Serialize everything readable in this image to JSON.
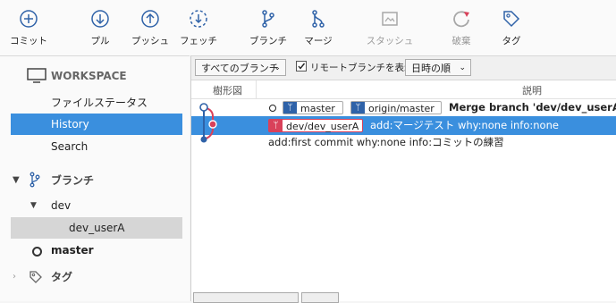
{
  "toolbar": {
    "items": [
      {
        "label": "コミット",
        "icon": "plus-circle-icon"
      },
      {
        "label": "プル",
        "icon": "arrow-down-circle-icon"
      },
      {
        "label": "プッシュ",
        "icon": "arrow-up-circle-icon"
      },
      {
        "label": "フェッチ",
        "icon": "fetch-dashed-circle-icon"
      },
      {
        "label": "ブランチ",
        "icon": "branch-icon"
      },
      {
        "label": "マージ",
        "icon": "merge-icon"
      },
      {
        "label": "スタッシュ",
        "icon": "stash-icon",
        "disabled": true
      },
      {
        "label": "破棄",
        "icon": "discard-icon",
        "disabled": true
      },
      {
        "label": "タグ",
        "icon": "tag-icon"
      }
    ]
  },
  "sidebar": {
    "workspace_label": "WORKSPACE",
    "file_status": "ファイルステータス",
    "history": "History",
    "search": "Search",
    "branches_label": "ブランチ",
    "branch_folder": "dev",
    "branch_dev_usera": "dev_userA",
    "branch_master": "master",
    "tags_label": "タグ"
  },
  "filterbar": {
    "branch_filter": "すべてのブランチ",
    "show_remote_label": "リモートブランチを表示",
    "show_remote_checked": true,
    "sort_order": "日時の順"
  },
  "columns": {
    "graph": "樹形図",
    "description": "説明"
  },
  "commits": [
    {
      "tags": [
        {
          "name": "master",
          "kind": "local"
        },
        {
          "name": "origin/master",
          "kind": "remote"
        }
      ],
      "message": "Merge branch 'dev/dev_userA'",
      "selected": false
    },
    {
      "tags": [
        {
          "name": "dev/dev_userA",
          "kind": "current"
        }
      ],
      "message": "add:マージテスト why:none info:none",
      "selected": true
    },
    {
      "tags": [],
      "message": "add:first commit why:none info:コミットの練習",
      "selected": false
    }
  ],
  "colors": {
    "accent": "#3a8fde",
    "graph_blue": "#2f62a8",
    "graph_red": "#d9415a"
  }
}
